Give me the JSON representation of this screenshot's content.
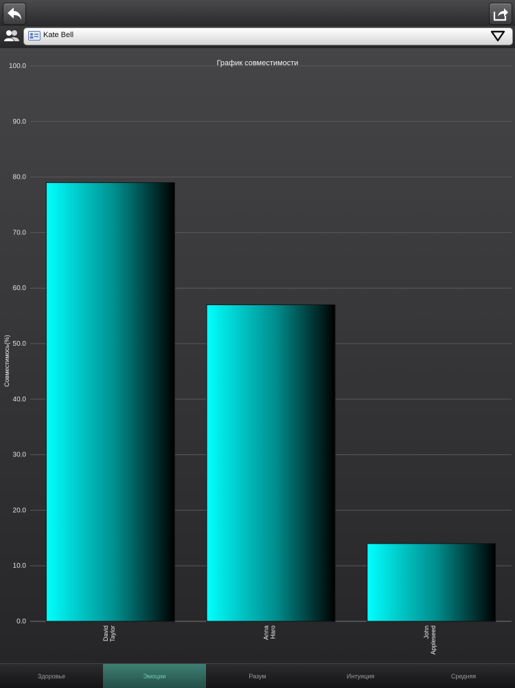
{
  "header": {
    "back_icon": "back-arrow-icon",
    "share_icon": "share-icon"
  },
  "selector": {
    "people_icon": "people-icon",
    "contact_icon": "contact-card-icon",
    "value": "Kate Bell",
    "arrow_icon": "chevron-down-icon"
  },
  "chart_data": {
    "type": "bar",
    "title": "График совместимости",
    "ylabel": "Совместимось(%)",
    "xlabel": "",
    "ylim": [
      0,
      100
    ],
    "yticks": [
      "0.0",
      "10.0",
      "20.0",
      "30.0",
      "40.0",
      "50.0",
      "60.0",
      "70.0",
      "80.0",
      "90.0",
      "100.0"
    ],
    "categories": [
      [
        "David",
        "Taylor"
      ],
      [
        "Anna",
        "Haro"
      ],
      [
        "John",
        "Appleseed"
      ]
    ],
    "values": [
      79,
      57,
      14
    ],
    "bar_color": "#00ffff",
    "grid": true
  },
  "tabs": [
    {
      "label": "Здоровье",
      "active": false
    },
    {
      "label": "Эмоции",
      "active": true
    },
    {
      "label": "Разум",
      "active": false
    },
    {
      "label": "Интуиция",
      "active": false
    },
    {
      "label": "Средняя",
      "active": false
    }
  ]
}
